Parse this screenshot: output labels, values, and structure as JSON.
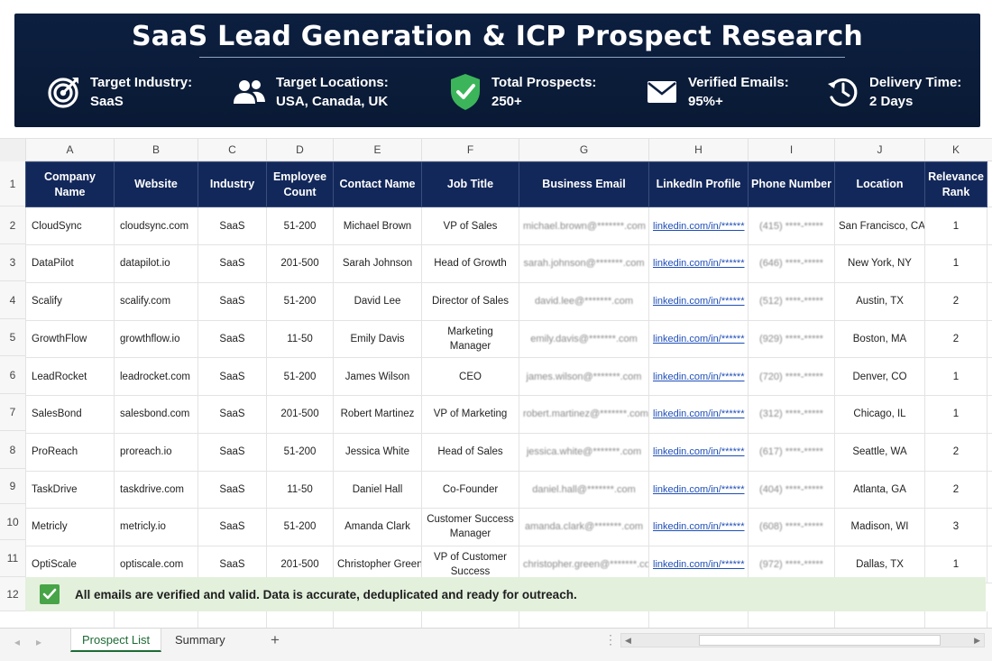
{
  "banner": {
    "title": "SaaS Lead Generation & ICP Prospect Research",
    "stats": [
      {
        "icon": "target-icon",
        "label": "Target Industry:",
        "value": "SaaS"
      },
      {
        "icon": "people-icon",
        "label": "Target Locations:",
        "value": "USA, Canada, UK"
      },
      {
        "icon": "shield-check-icon",
        "label": "Total Prospects:",
        "value": "250+"
      },
      {
        "icon": "mail-icon",
        "label": "Verified Emails:",
        "value": "95%+"
      },
      {
        "icon": "history-clock-icon",
        "label": "Delivery Time:",
        "value": "2 Days"
      }
    ]
  },
  "column_letters": [
    "A",
    "B",
    "C",
    "D",
    "E",
    "F",
    "G",
    "H",
    "I",
    "J",
    "K"
  ],
  "row_numbers": [
    "1",
    "2",
    "3",
    "4",
    "5",
    "6",
    "7",
    "8",
    "9",
    "10",
    "11",
    "12"
  ],
  "table": {
    "headers": [
      "Company Name",
      "Website",
      "Industry",
      "Employee Count",
      "Contact Name",
      "Job Title",
      "Business Email",
      "LinkedIn Profile",
      "Phone Number",
      "Location",
      "Relevance Rank"
    ],
    "rows": [
      [
        "CloudSync",
        "cloudsync.com",
        "SaaS",
        "51-200",
        "Michael Brown",
        "VP of Sales",
        "michael.brown@*******.com",
        "linkedin.com/in/******",
        "(415) ****-*****",
        "San Francisco, CA",
        "1"
      ],
      [
        "DataPilot",
        "datapilot.io",
        "SaaS",
        "201-500",
        "Sarah Johnson",
        "Head of Growth",
        "sarah.johnson@*******.com",
        "linkedin.com/in/******",
        "(646) ****-*****",
        "New York, NY",
        "1"
      ],
      [
        "Scalify",
        "scalify.com",
        "SaaS",
        "51-200",
        "David Lee",
        "Director of Sales",
        "david.lee@*******.com",
        "linkedin.com/in/******",
        "(512) ****-*****",
        "Austin, TX",
        "2"
      ],
      [
        "GrowthFlow",
        "growthflow.io",
        "SaaS",
        "11-50",
        "Emily Davis",
        "Marketing Manager",
        "emily.davis@*******.com",
        "linkedin.com/in/******",
        "(929) ****-*****",
        "Boston, MA",
        "2"
      ],
      [
        "LeadRocket",
        "leadrocket.com",
        "SaaS",
        "51-200",
        "James Wilson",
        "CEO",
        "james.wilson@*******.com",
        "linkedin.com/in/******",
        "(720) ****-*****",
        "Denver, CO",
        "1"
      ],
      [
        "SalesBond",
        "salesbond.com",
        "SaaS",
        "201-500",
        "Robert Martinez",
        "VP of Marketing",
        "robert.martinez@*******.com",
        "linkedin.com/in/******",
        "(312) ****-*****",
        "Chicago, IL",
        "1"
      ],
      [
        "ProReach",
        "proreach.io",
        "SaaS",
        "51-200",
        "Jessica White",
        "Head of Sales",
        "jessica.white@*******.com",
        "linkedin.com/in/******",
        "(617) ****-*****",
        "Seattle, WA",
        "2"
      ],
      [
        "TaskDrive",
        "taskdrive.com",
        "SaaS",
        "11-50",
        "Daniel Hall",
        "Co-Founder",
        "daniel.hall@*******.com",
        "linkedin.com/in/******",
        "(404) ****-*****",
        "Atlanta, GA",
        "2"
      ],
      [
        "Metricly",
        "metricly.io",
        "SaaS",
        "51-200",
        "Amanda Clark",
        "Customer Success Manager",
        "amanda.clark@*******.com",
        "linkedin.com/in/******",
        "(608) ****-*****",
        "Madison, WI",
        "3"
      ],
      [
        "OptiScale",
        "optiscale.com",
        "SaaS",
        "201-500",
        "Christopher Green",
        "VP of Customer Success",
        "christopher.green@*******.com",
        "linkedin.com/in/******",
        "(972) ****-*****",
        "Dallas, TX",
        "1"
      ]
    ]
  },
  "note": "All emails are verified and valid. Data is accurate, deduplicated and ready for outreach.",
  "sheet_tabs": [
    {
      "label": "Prospect List",
      "active": true
    },
    {
      "label": "Summary",
      "active": false
    }
  ],
  "add_sheet": "+",
  "colors": {
    "header_navy": "#13285a",
    "banner_navy": "#0c1f3f",
    "check_green": "#47a447",
    "note_bg": "#e3f0dc",
    "link_blue": "#1f4fb8"
  }
}
